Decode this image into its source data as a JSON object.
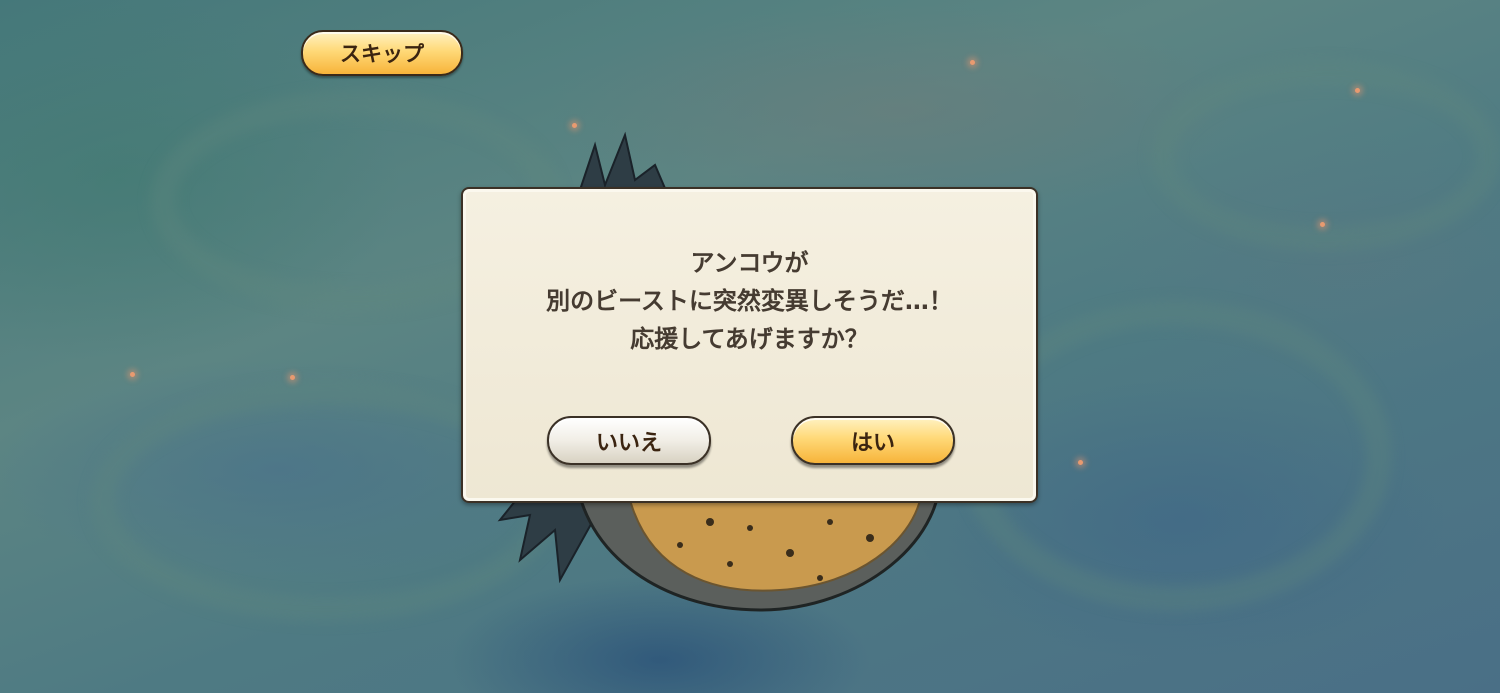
{
  "skip_button": {
    "label": "スキップ"
  },
  "dialog": {
    "message_lines": [
      "アンコウが",
      "別のビーストに突然変異しそうだ…！",
      "応援してあげますか？"
    ],
    "no_label": "いいえ",
    "yes_label": "はい"
  },
  "colors": {
    "accent_button": "#ffd978",
    "dialog_background": "#f3eddd",
    "text": "#453b31"
  }
}
